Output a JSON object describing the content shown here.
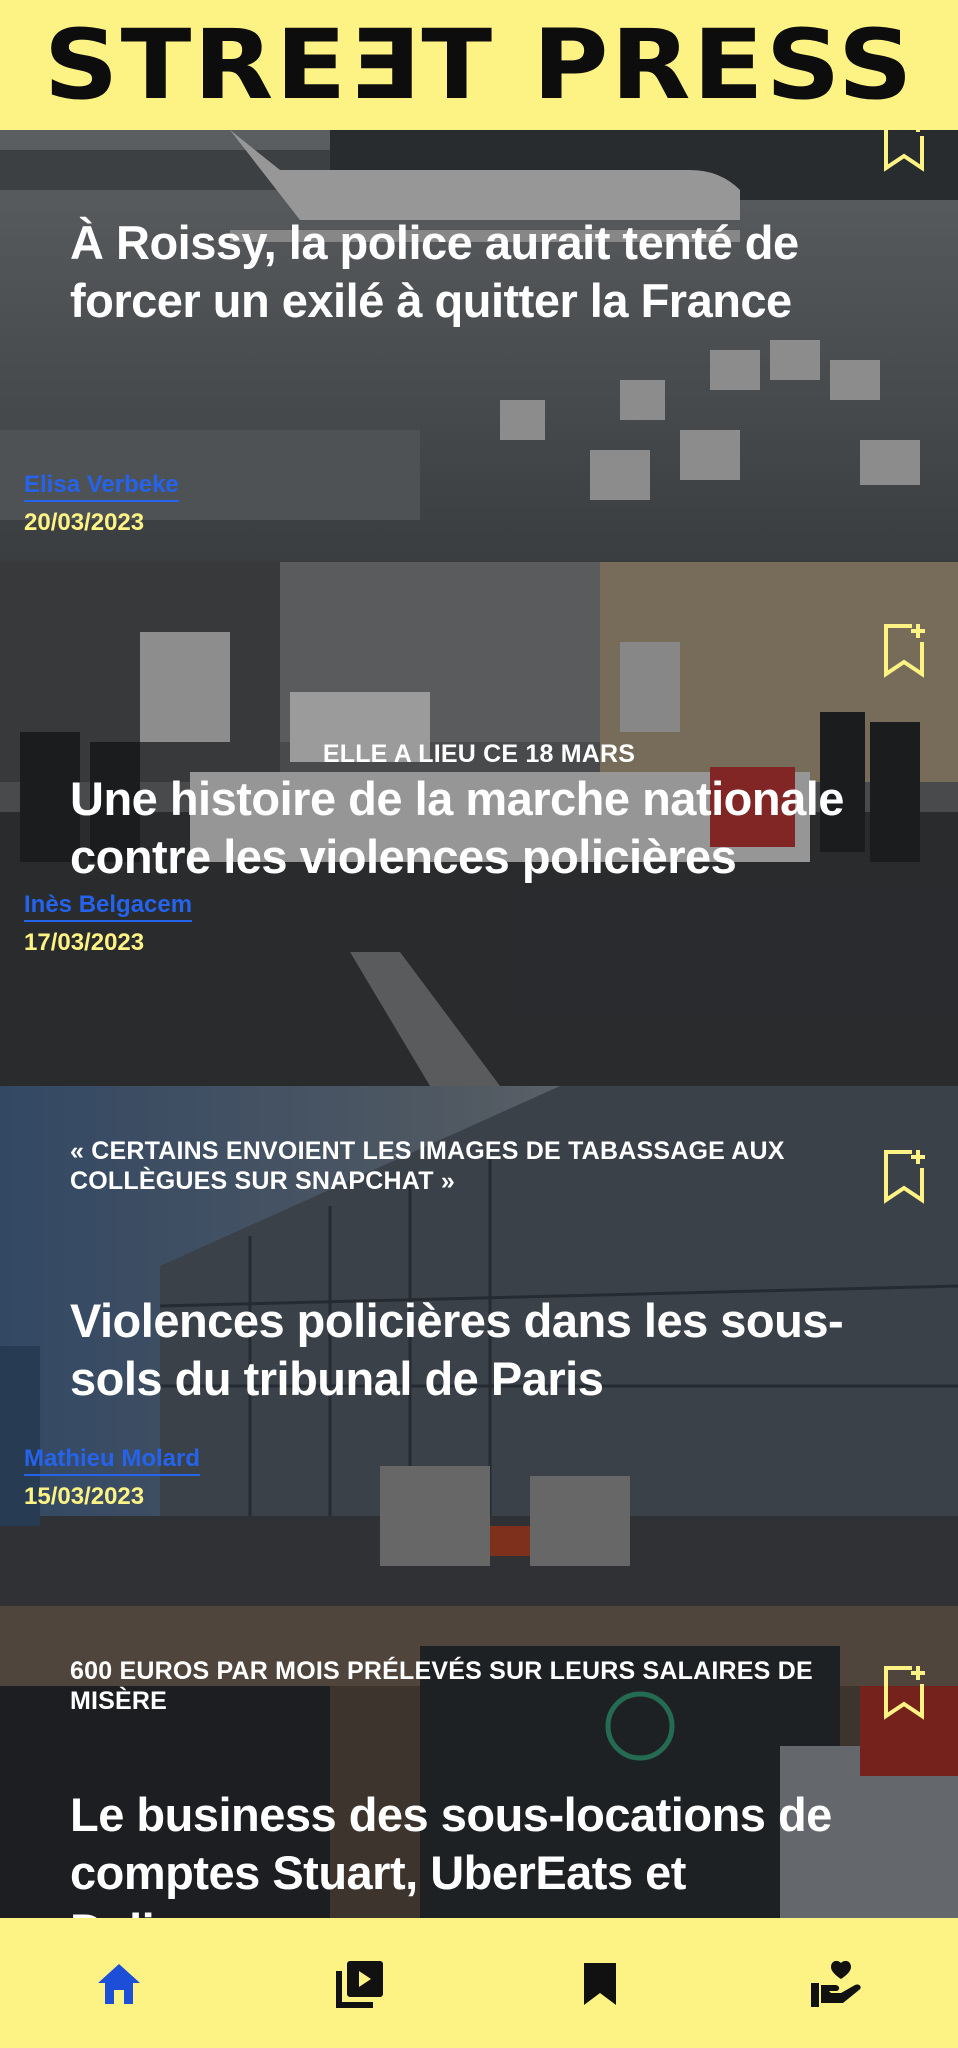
{
  "header": {
    "logo_text": "STREƎT PRESS"
  },
  "colors": {
    "brand_yellow": "#fdf385",
    "author_blue": "#2563eb",
    "active_nav": "#1d4ed8"
  },
  "articles": [
    {
      "kicker": "",
      "title": "À Roissy, la police aurait tenté de forcer un exilé à quitter la France",
      "author": "Elisa Verbeke",
      "date": "20/03/2023",
      "icon": "bookmark-add-icon"
    },
    {
      "kicker": "ELLE A LIEU CE 18 MARS",
      "title": "Une histoire de la marche nationale contre les violences policières",
      "author": "Inès Belgacem",
      "date": "17/03/2023",
      "icon": "bookmark-add-icon"
    },
    {
      "kicker": "« CERTAINS ENVOIENT LES IMAGES DE TABASSAGE AUX COLLÈGUES SUR SNAPCHAT »",
      "title": "Violences policières dans les sous-sols du tribunal de Paris",
      "author": "Mathieu Molard",
      "date": "15/03/2023",
      "icon": "bookmark-add-icon"
    },
    {
      "kicker": "600 EUROS PAR MOIS PRÉLEVÉS SUR LEURS SALAIRES DE MISÈRE",
      "title": "Le business des sous-locations de comptes Stuart, UberEats et Deliveroo",
      "author": "",
      "date": "",
      "icon": "bookmark-add-icon"
    }
  ],
  "bottom_nav": [
    {
      "icon": "home-icon",
      "active": true
    },
    {
      "icon": "video-library-icon",
      "active": false
    },
    {
      "icon": "bookmark-icon",
      "active": false
    },
    {
      "icon": "donate-heart-hand-icon",
      "active": false
    }
  ]
}
